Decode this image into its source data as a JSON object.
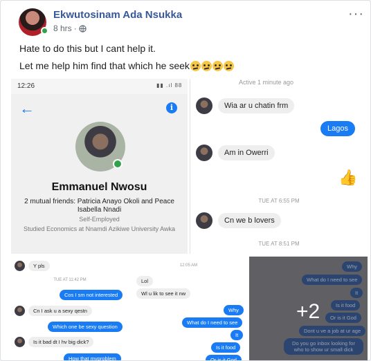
{
  "post": {
    "author": "Ekwutosinam Ada Nsukka",
    "time": "8 hrs",
    "dot": "·",
    "more": "···",
    "line1": "Hate to do this but I cant help it.",
    "line2": "Let me help him find that which he seek",
    "emoji_count": 4
  },
  "profile": {
    "clock": "12:26",
    "status_icons": "▮▮ .ıl 88",
    "name": "Emmanuel Nwosu",
    "mutual": "2 mutual friends: Patricia Anayo Okoli and Peace Isabella Nnadi",
    "job": "Self-Employed",
    "school": "Studied Economics at Nnamdi Azikiwe University Awka"
  },
  "chat1": {
    "status": "Active 1 minute ago",
    "m1": "Wia ar u chatin frm",
    "m2": "Lagos",
    "m3": "Am in Owerri",
    "ts1": "TUE AT 6:55 PM",
    "m4": "Cn we b lovers",
    "ts2": "TUE AT 8:51 PM"
  },
  "chat2": {
    "m1": "Y pls",
    "ts1": "TUE AT 11:42 PM",
    "m2": "Cos I sm not interested",
    "m3": "Cn I ask u a sexy qestn",
    "m4": "Which one be sexy question",
    "m5": "Is it bad dt I hv big dick?",
    "m6": "How that mvproblem"
  },
  "chat3": {
    "ts1": "12:05 AM",
    "m1": "Lol",
    "m2": "Wl u lik to see it nw",
    "m3": "Why",
    "m4": "What do I need to see",
    "m5": "It",
    "m6": "Is it food",
    "m7": "Or is it God"
  },
  "chat4": {
    "m1": "Why",
    "m2": "What do I need to see",
    "m3": "It",
    "m4": "Is it food",
    "m5": "Or is it God",
    "m6": "Dont u ve a job at ur age",
    "m7": "Do you go inbox looking for who to show ur small dick",
    "more": "+2"
  },
  "colors": {
    "brand": "#385898",
    "messenger_blue": "#1a7cf5",
    "online": "#31a24c"
  }
}
